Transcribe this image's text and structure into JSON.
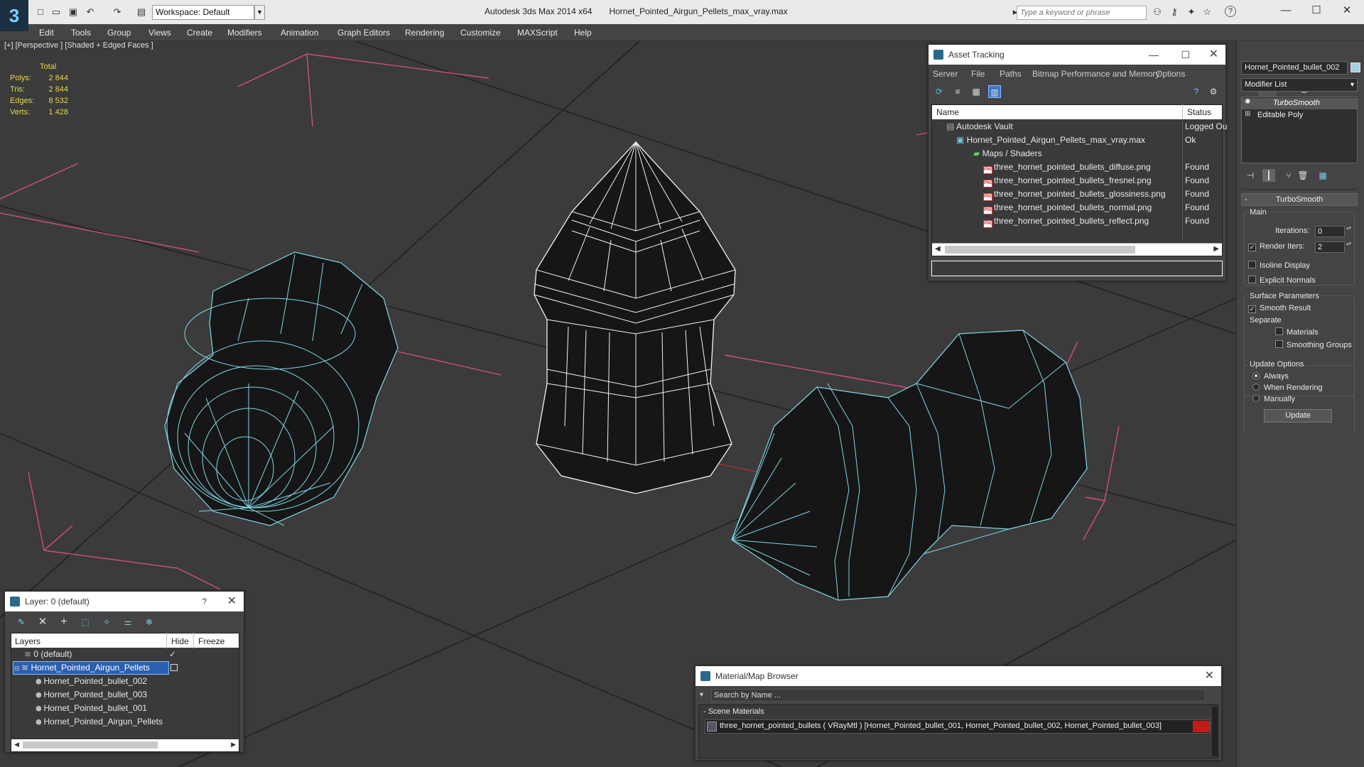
{
  "app": {
    "title": "Autodesk 3ds Max  2014 x64",
    "file": "Hornet_Pointed_Airgun_Pellets_max_vray.max",
    "workspace": "Workspace: Default",
    "search_placeholder": "Type a keyword or phrase"
  },
  "menu": [
    "Edit",
    "Tools",
    "Group",
    "Views",
    "Create",
    "Modifiers",
    "Animation",
    "Graph Editors",
    "Rendering",
    "Customize",
    "MAXScript",
    "Help"
  ],
  "viewport": {
    "label": "[+] [Perspective ] [Shaded + Edged Faces ]",
    "stats": {
      "total_label": "Total",
      "rows": [
        {
          "label": "Polys:",
          "value": "2 844"
        },
        {
          "label": "Tris:",
          "value": "2 844"
        },
        {
          "label": "Edges:",
          "value": "8 532"
        },
        {
          "label": "Verts:",
          "value": "1 428"
        }
      ]
    }
  },
  "asset_tracking": {
    "title": "Asset Tracking",
    "menu": [
      "Server",
      "File",
      "Paths",
      "Bitmap Performance and Memory",
      "Options"
    ],
    "columns": [
      "Name",
      "Status"
    ],
    "rows": [
      {
        "name": "Autodesk Vault",
        "status": "Logged Ou",
        "indent": 0
      },
      {
        "name": "Hornet_Pointed_Airgun_Pellets_max_vray.max",
        "status": "Ok",
        "indent": 1
      },
      {
        "name": "Maps / Shaders",
        "status": "",
        "indent": 2
      },
      {
        "name": "three_hornet_pointed_bullets_diffuse.png",
        "status": "Found",
        "indent": 3
      },
      {
        "name": "three_hornet_pointed_bullets_fresnel.png",
        "status": "Found",
        "indent": 3
      },
      {
        "name": "three_hornet_pointed_bullets_glossiness.png",
        "status": "Found",
        "indent": 3
      },
      {
        "name": "three_hornet_pointed_bullets_normal.png",
        "status": "Found",
        "indent": 3
      },
      {
        "name": "three_hornet_pointed_bullets_reflect.png",
        "status": "Found",
        "indent": 3
      }
    ]
  },
  "layer_panel": {
    "title": "Layer: 0 (default)",
    "columns": [
      "Layers",
      "Hide",
      "Freeze"
    ],
    "rows": [
      "0 (default)",
      "Hornet_Pointed_Airgun_Pellets",
      "Hornet_Pointed_bullet_002",
      "Hornet_Pointed_bullet_003",
      "Hornet_Pointed_bullet_001",
      "Hornet_Pointed_Airgun_Pellets"
    ]
  },
  "material_browser": {
    "title": "Material/Map Browser",
    "search_placeholder": "Search by Name ...",
    "section": "- Scene Materials",
    "material": "three_hornet_pointed_bullets  ( VRayMtl ) [Hornet_Pointed_bullet_001, Hornet_Pointed_bullet_002, Hornet_Pointed_bullet_003]",
    "swatch_color": "#c41a1a"
  },
  "command_panel": {
    "object_name": "Hornet_Pointed_bullet_002",
    "modifier_list": "Modifier List",
    "stack": [
      "TurboSmooth",
      "Editable Poly"
    ],
    "rollout_title": "TurboSmooth",
    "main_label": "Main",
    "iterations_label": "Iterations:",
    "iterations": "0",
    "render_iters_label": "Render Iters:",
    "render_iters": "2",
    "isoline_label": "Isoline Display",
    "explicit_label": "Explicit Normals",
    "surface_label": "Surface Parameters",
    "smooth_label": "Smooth Result",
    "separate_label": "Separate",
    "materials_label": "Materials",
    "smoothing_label": "Smoothing Groups",
    "update_options_label": "Update Options",
    "always_label": "Always",
    "when_rendering_label": "When Rendering",
    "manually_label": "Manually",
    "update_button": "Update"
  }
}
